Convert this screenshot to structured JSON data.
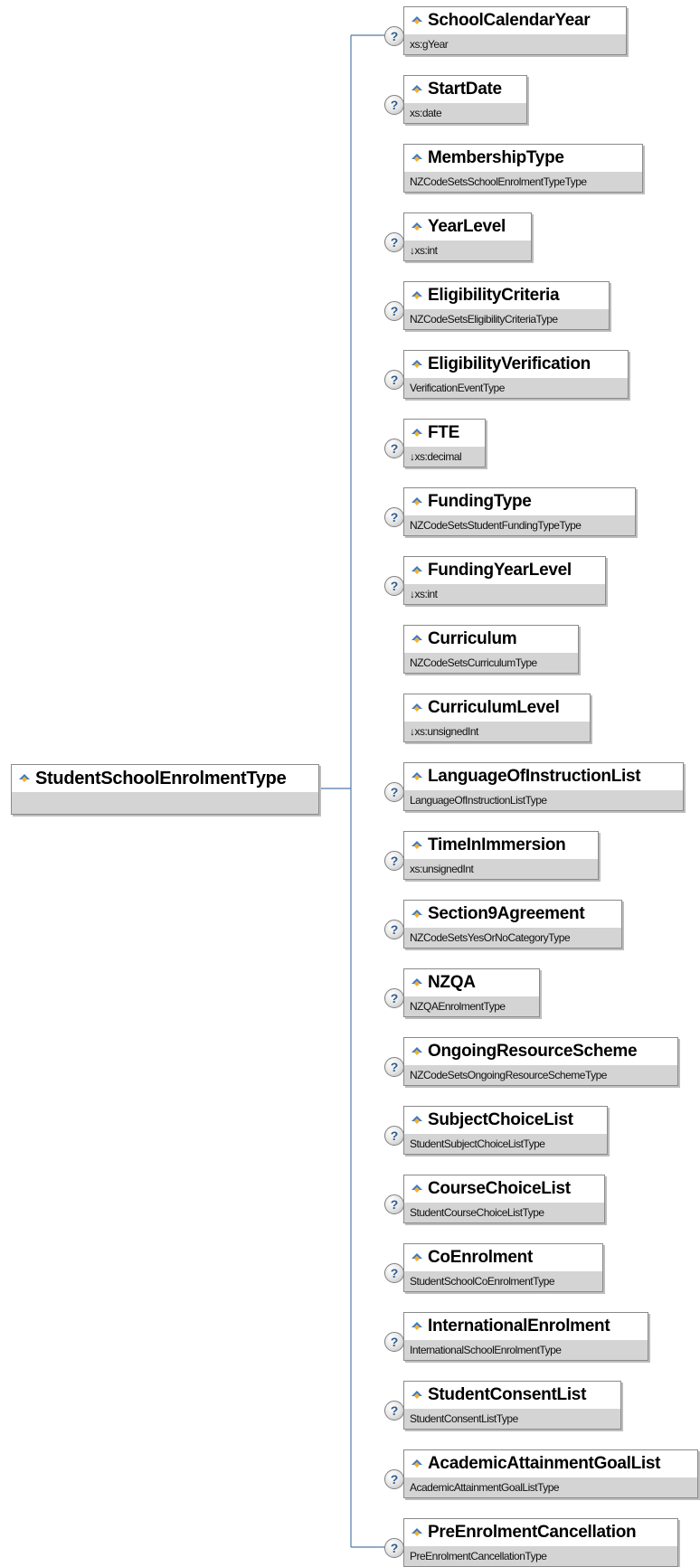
{
  "root": {
    "name": "StudentSchoolEnrolmentType"
  },
  "icons": {
    "element": "element-icon",
    "optional": "optional-icon"
  },
  "optional_symbol": "?",
  "elements": [
    {
      "name": "SchoolCalendarYear",
      "type": "xs:gYear",
      "optional": true
    },
    {
      "name": "StartDate",
      "type": "xs:date",
      "optional": true
    },
    {
      "name": "MembershipType",
      "type": "NZCodeSetsSchoolEnrolmentTypeType",
      "optional": false
    },
    {
      "name": "YearLevel",
      "type": "↓xs:int",
      "optional": true
    },
    {
      "name": "EligibilityCriteria",
      "type": "NZCodeSetsEligibilityCriteriaType",
      "optional": true
    },
    {
      "name": "EligibilityVerification",
      "type": "VerificationEventType",
      "optional": true
    },
    {
      "name": "FTE",
      "type": "↓xs:decimal",
      "optional": true
    },
    {
      "name": "FundingType",
      "type": "NZCodeSetsStudentFundingTypeType",
      "optional": true
    },
    {
      "name": "FundingYearLevel",
      "type": "↓xs:int",
      "optional": true
    },
    {
      "name": "Curriculum",
      "type": "NZCodeSetsCurriculumType",
      "optional": false
    },
    {
      "name": "CurriculumLevel",
      "type": "↓xs:unsignedInt",
      "optional": false
    },
    {
      "name": "LanguageOfInstructionList",
      "type": "LanguageOfInstructionListType",
      "optional": true
    },
    {
      "name": "TimeInImmersion",
      "type": "xs:unsignedInt",
      "optional": true
    },
    {
      "name": "Section9Agreement",
      "type": "NZCodeSetsYesOrNoCategoryType",
      "optional": true
    },
    {
      "name": "NZQA",
      "type": "NZQAEnrolmentType",
      "optional": true
    },
    {
      "name": "OngoingResourceScheme",
      "type": "NZCodeSetsOngoingResourceSchemeType",
      "optional": true
    },
    {
      "name": "SubjectChoiceList",
      "type": "StudentSubjectChoiceListType",
      "optional": true
    },
    {
      "name": "CourseChoiceList",
      "type": "StudentCourseChoiceListType",
      "optional": true
    },
    {
      "name": "CoEnrolment",
      "type": "StudentSchoolCoEnrolmentType",
      "optional": true
    },
    {
      "name": "InternationalEnrolment",
      "type": "InternationalSchoolEnrolmentType",
      "optional": true
    },
    {
      "name": "StudentConsentList",
      "type": "StudentConsentListType",
      "optional": true
    },
    {
      "name": "AcademicAttainmentGoalList",
      "type": "AcademicAttainmentGoalListType",
      "optional": true
    },
    {
      "name": "PreEnrolmentCancellation",
      "type": "PreEnrolmentCancellationType",
      "optional": true
    }
  ]
}
